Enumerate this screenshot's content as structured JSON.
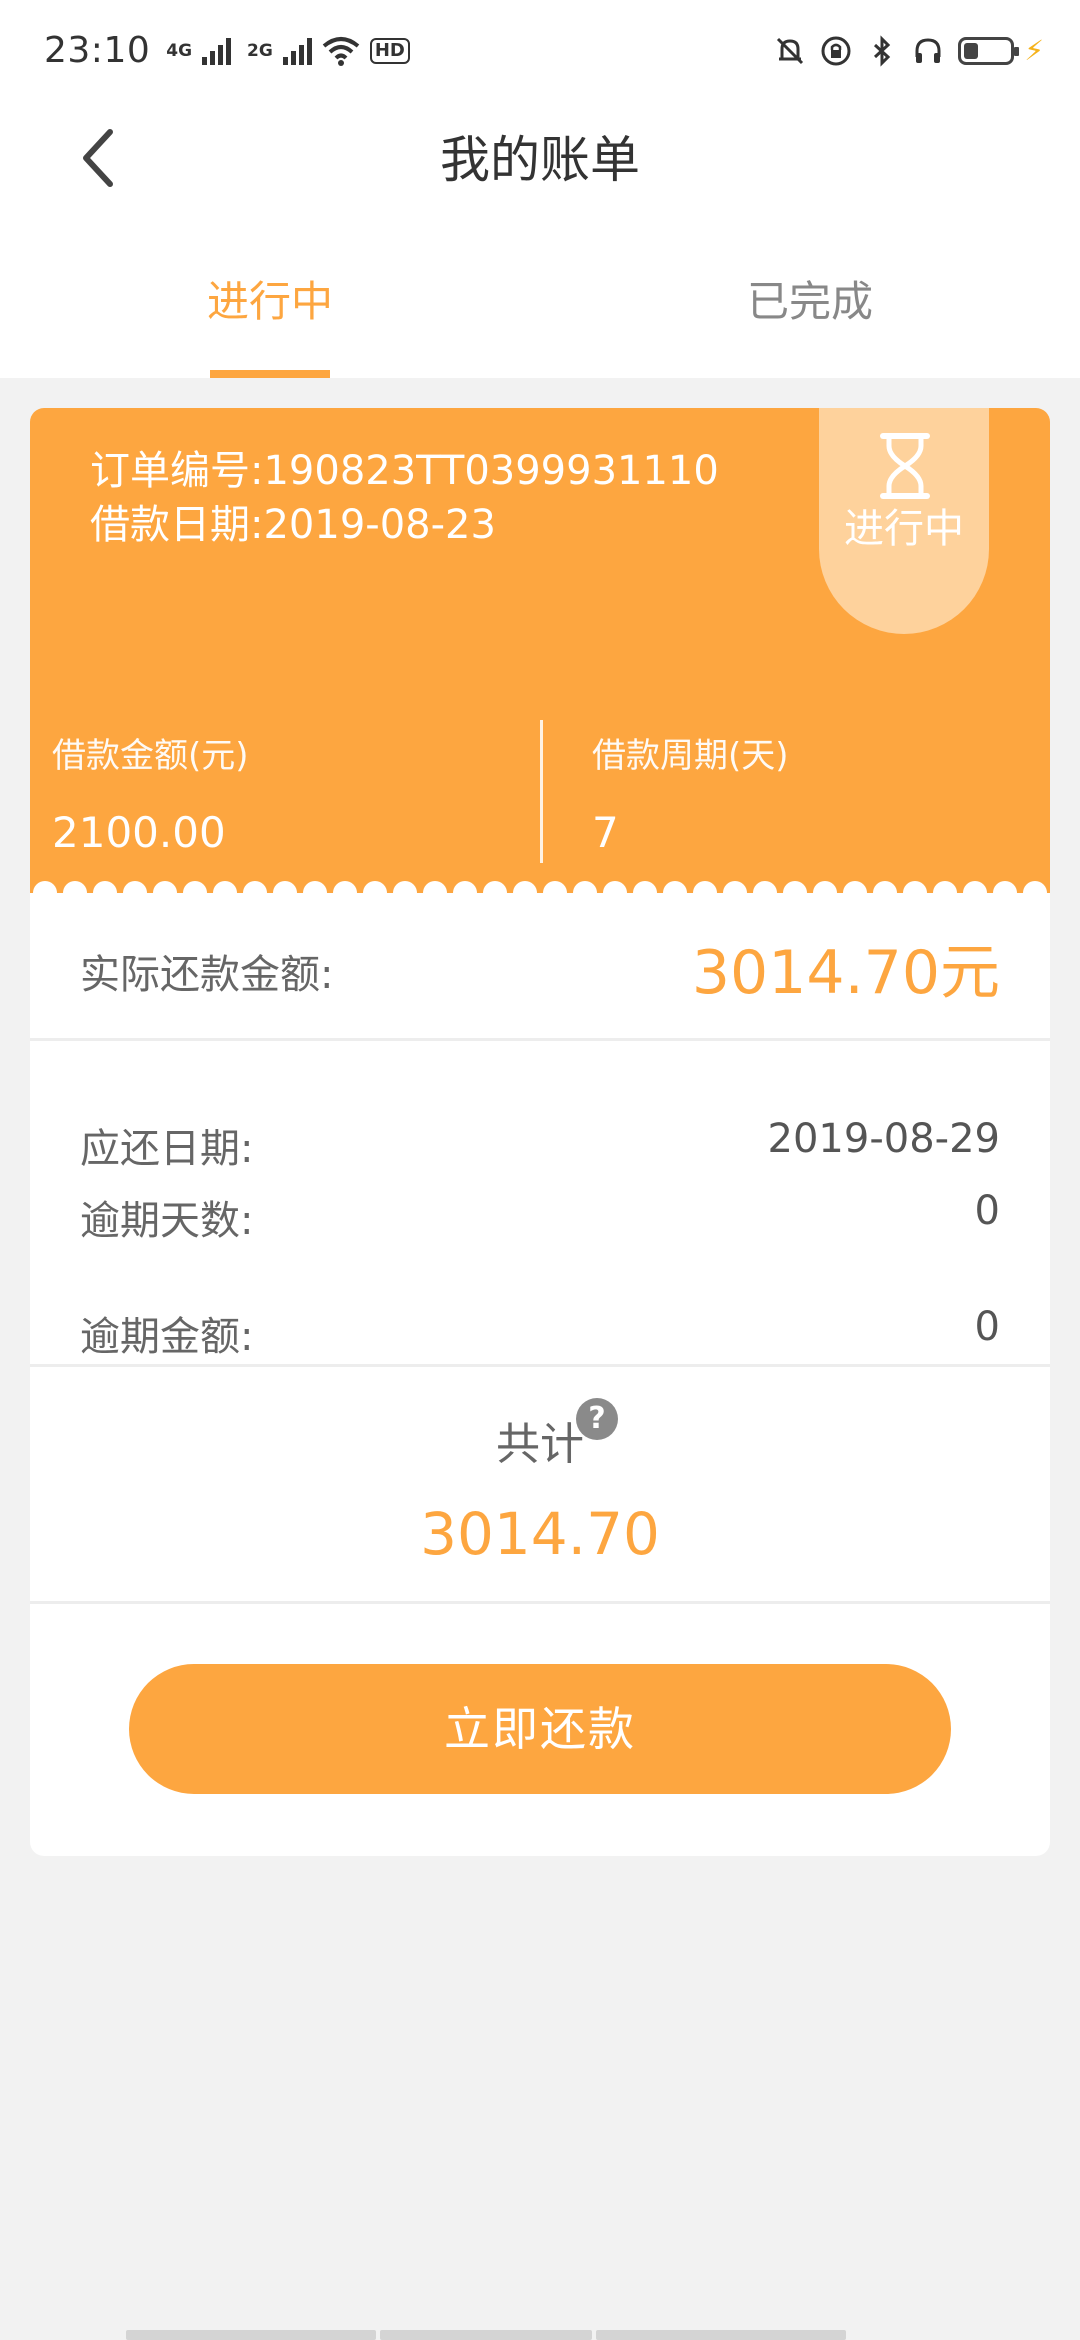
{
  "status_bar": {
    "time": "23:10",
    "net1": "4G",
    "net2": "2G",
    "hd": "HD"
  },
  "header": {
    "title": "我的账单"
  },
  "tabs": [
    {
      "label": "进行中"
    },
    {
      "label": "已完成"
    }
  ],
  "order": {
    "order_no": "订单编号:190823TT0399931110",
    "loan_date": "借款日期:2019-08-23",
    "status": "进行中",
    "amount_label": "借款金额(元)",
    "amount_value": "2100.00",
    "period_label": "借款周期(天)",
    "period_value": "7"
  },
  "details": {
    "actual_label": "实际还款金额:",
    "actual_value": "3014.70元",
    "due_label": "应还日期:",
    "due_value": "2019-08-29",
    "overdue_days_label": "逾期天数:",
    "overdue_days_value": "0",
    "overdue_amount_label": "逾期金额:",
    "overdue_amount_value": "0",
    "total_label": "共计",
    "total_help": "?",
    "total_value": "3014.70"
  },
  "actions": {
    "pay_now": "立即还款"
  },
  "colors": {
    "accent": "#fda640",
    "badge": "#fed29c"
  }
}
